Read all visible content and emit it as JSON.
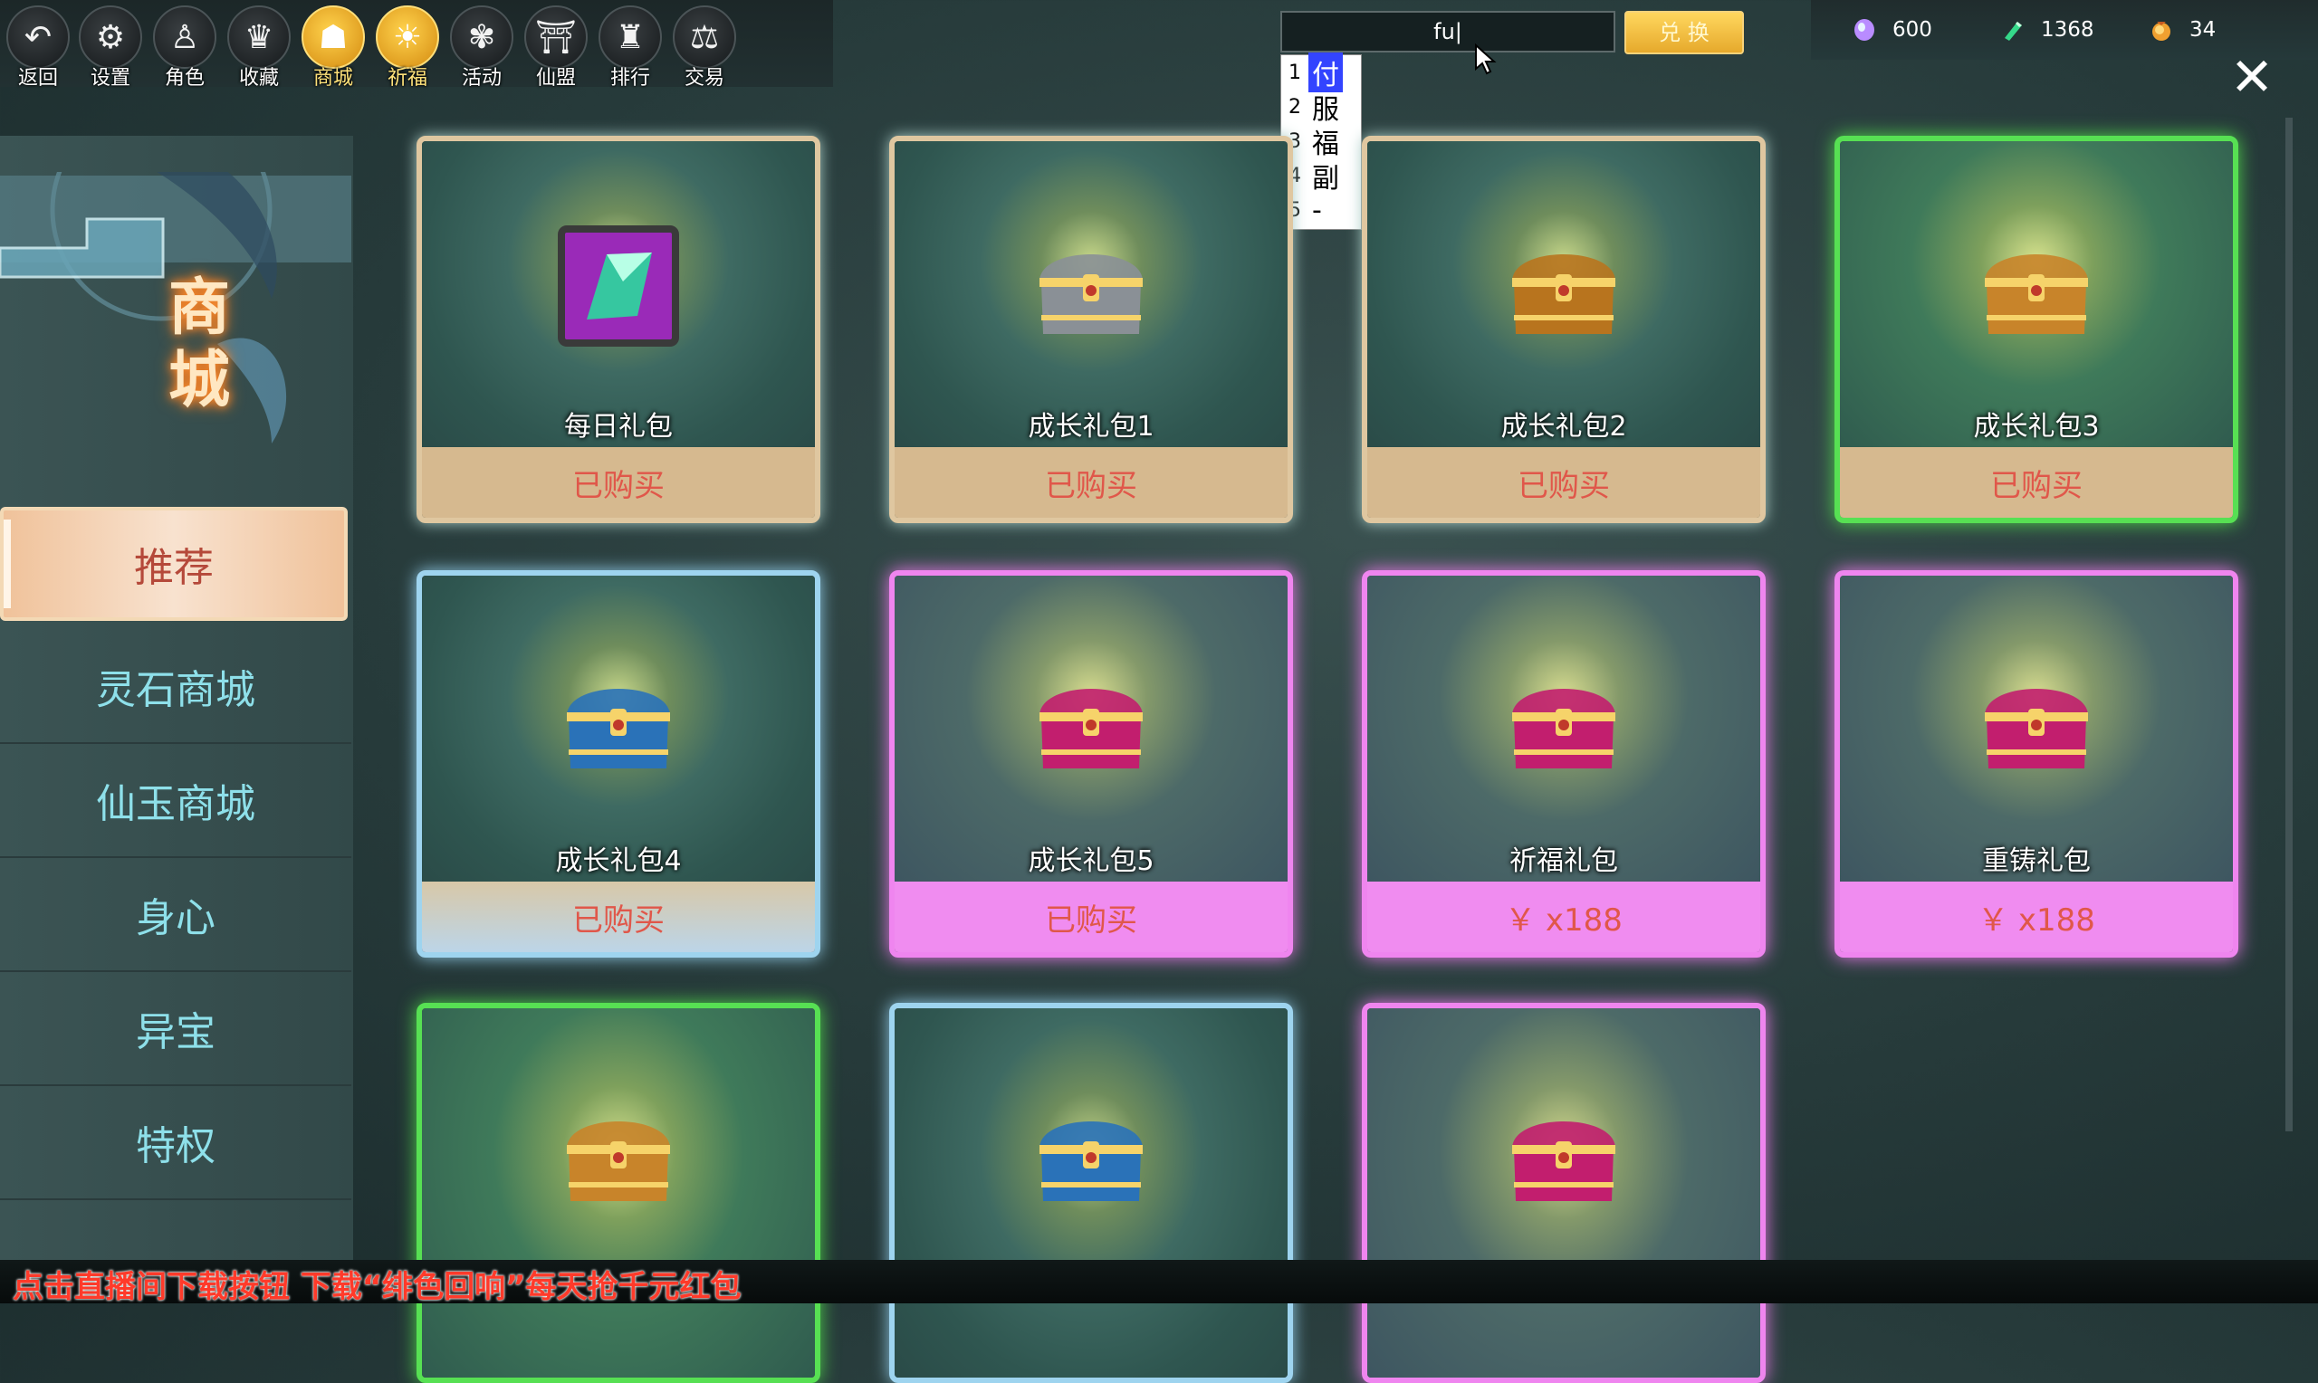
{
  "toolbar": {
    "items": [
      {
        "label": "返回",
        "icon": "back-arrow-icon",
        "glyph": "↶",
        "active": false
      },
      {
        "label": "设置",
        "icon": "gear-icon",
        "glyph": "⚙",
        "active": false
      },
      {
        "label": "角色",
        "icon": "character-icon",
        "glyph": "♙",
        "active": false
      },
      {
        "label": "收藏",
        "icon": "collection-icon",
        "glyph": "♛",
        "active": false
      },
      {
        "label": "商城",
        "icon": "shop-icon",
        "glyph": "☗",
        "active": true
      },
      {
        "label": "祈福",
        "icon": "blessing-icon",
        "glyph": "☀",
        "active": true
      },
      {
        "label": "活动",
        "icon": "activity-icon",
        "glyph": "✾",
        "active": false
      },
      {
        "label": "仙盟",
        "icon": "guild-icon",
        "glyph": "⛩",
        "active": false
      },
      {
        "label": "排行",
        "icon": "ranking-icon",
        "glyph": "♜",
        "active": false
      },
      {
        "label": "交易",
        "icon": "trade-icon",
        "glyph": "⚖",
        "active": false
      }
    ]
  },
  "exchange": {
    "input_value": "fu|",
    "button_label": "兑 换"
  },
  "ime": {
    "candidates": [
      {
        "num": "1",
        "char": "付",
        "selected": true
      },
      {
        "num": "2",
        "char": "服",
        "selected": false
      },
      {
        "num": "3",
        "char": "福",
        "selected": false
      },
      {
        "num": "4",
        "char": "副",
        "selected": false
      },
      {
        "num": "5",
        "char": "-",
        "selected": false
      }
    ]
  },
  "currency": {
    "gem": {
      "icon": "spirit-gem-icon",
      "value": "600",
      "color": "#b98cff"
    },
    "jade": {
      "icon": "jade-icon",
      "value": "1368",
      "color": "#35d98a"
    },
    "coin": {
      "icon": "coin-bag-icon",
      "value": "34",
      "color": "#f0a030"
    }
  },
  "sidebar": {
    "title": "商城",
    "categories": [
      {
        "label": "推荐",
        "active": true
      },
      {
        "label": "灵石商城",
        "active": false
      },
      {
        "label": "仙玉商城",
        "active": false
      },
      {
        "label": "身心",
        "active": false
      },
      {
        "label": "异宝",
        "active": false
      },
      {
        "label": "特权",
        "active": false
      }
    ]
  },
  "products": [
    {
      "name": "每日礼包",
      "price": "已购买",
      "rarity": "tan",
      "icon": "crystal-icon"
    },
    {
      "name": "成长礼包1",
      "price": "已购买",
      "rarity": "tan",
      "icon": "silver-chest-icon"
    },
    {
      "name": "成长礼包2",
      "price": "已购买",
      "rarity": "tan",
      "icon": "gold-chest-icon"
    },
    {
      "name": "成长礼包3",
      "price": "已购买",
      "rarity": "green",
      "icon": "gold-chest-icon"
    },
    {
      "name": "成长礼包4",
      "price": "已购买",
      "rarity": "blue",
      "icon": "blue-chest-icon"
    },
    {
      "name": "成长礼包5",
      "price": "已购买",
      "rarity": "pink",
      "icon": "pink-chest-icon"
    },
    {
      "name": "祈福礼包",
      "price": "￥ x188",
      "rarity": "pink",
      "icon": "pink-chest-icon"
    },
    {
      "name": "重铸礼包",
      "price": "￥ x188",
      "rarity": "pink",
      "icon": "pink-chest-icon"
    },
    {
      "name": "",
      "price": "",
      "rarity": "green",
      "icon": "gold-chest-icon"
    },
    {
      "name": "",
      "price": "",
      "rarity": "blue",
      "icon": "blue-chest-icon"
    },
    {
      "name": "",
      "price": "",
      "rarity": "pink",
      "icon": "pink-chest-icon"
    }
  ],
  "marquee": "点击直播间下载按钮 下载“绯色回响”每天抢千元红包",
  "close_label": "✕"
}
